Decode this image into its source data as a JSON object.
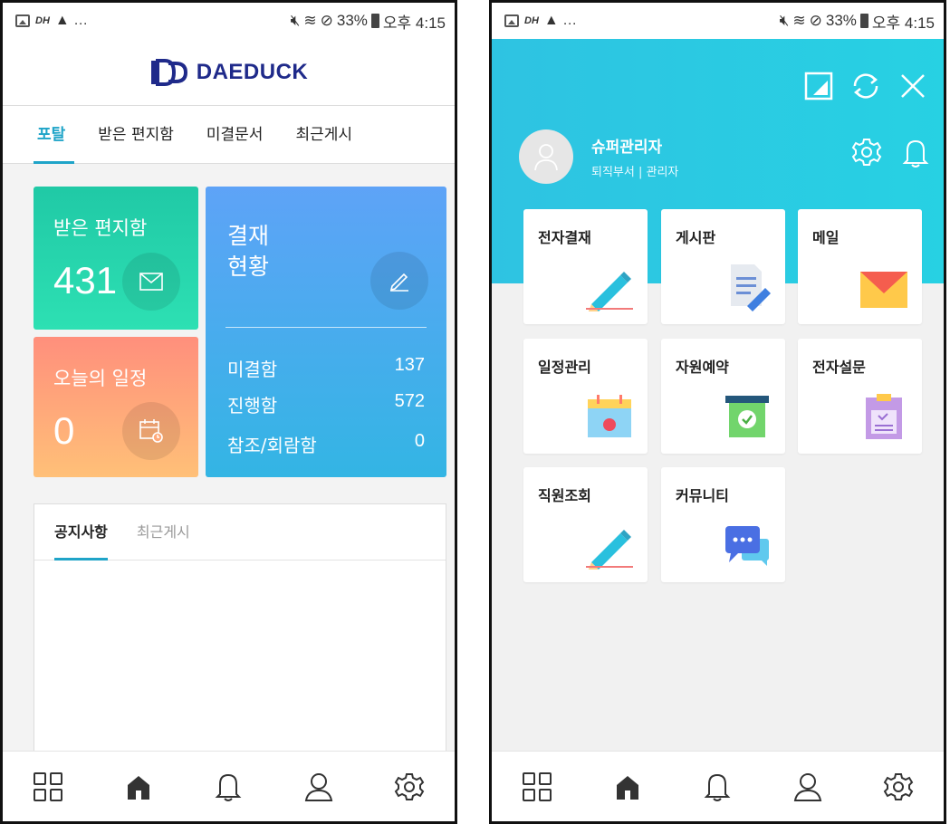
{
  "status": {
    "dh": "DH",
    "warn": "▲ …",
    "battery": "33%",
    "time": "오후 4:15"
  },
  "left": {
    "logo": "DAEDUCK",
    "tabs": [
      "포탈",
      "받은 편지함",
      "미결문서",
      "최근게시"
    ],
    "mail_card": {
      "title": "받은 편지함",
      "count": "431"
    },
    "schedule_card": {
      "title": "오늘의 일정",
      "count": "0"
    },
    "approval_card": {
      "title_line1": "결재",
      "title_line2": "현황",
      "rows": [
        {
          "label": "미결함",
          "value": "137"
        },
        {
          "label": "진행함",
          "value": "572"
        },
        {
          "label": "참조/회람함",
          "value": "0"
        }
      ]
    },
    "notice_tabs": [
      "공지사항",
      "최근게시"
    ]
  },
  "right": {
    "user": {
      "name": "슈퍼관리자",
      "dept": "퇴직부서 | 관리자"
    },
    "tiles": [
      "전자결재",
      "게시판",
      "메일",
      "일정관리",
      "자원예약",
      "전자설문",
      "직원조회",
      "커뮤니티"
    ]
  },
  "bottom_nav": [
    "grid-icon",
    "home-icon",
    "bell-icon",
    "person-icon",
    "gear-icon"
  ]
}
